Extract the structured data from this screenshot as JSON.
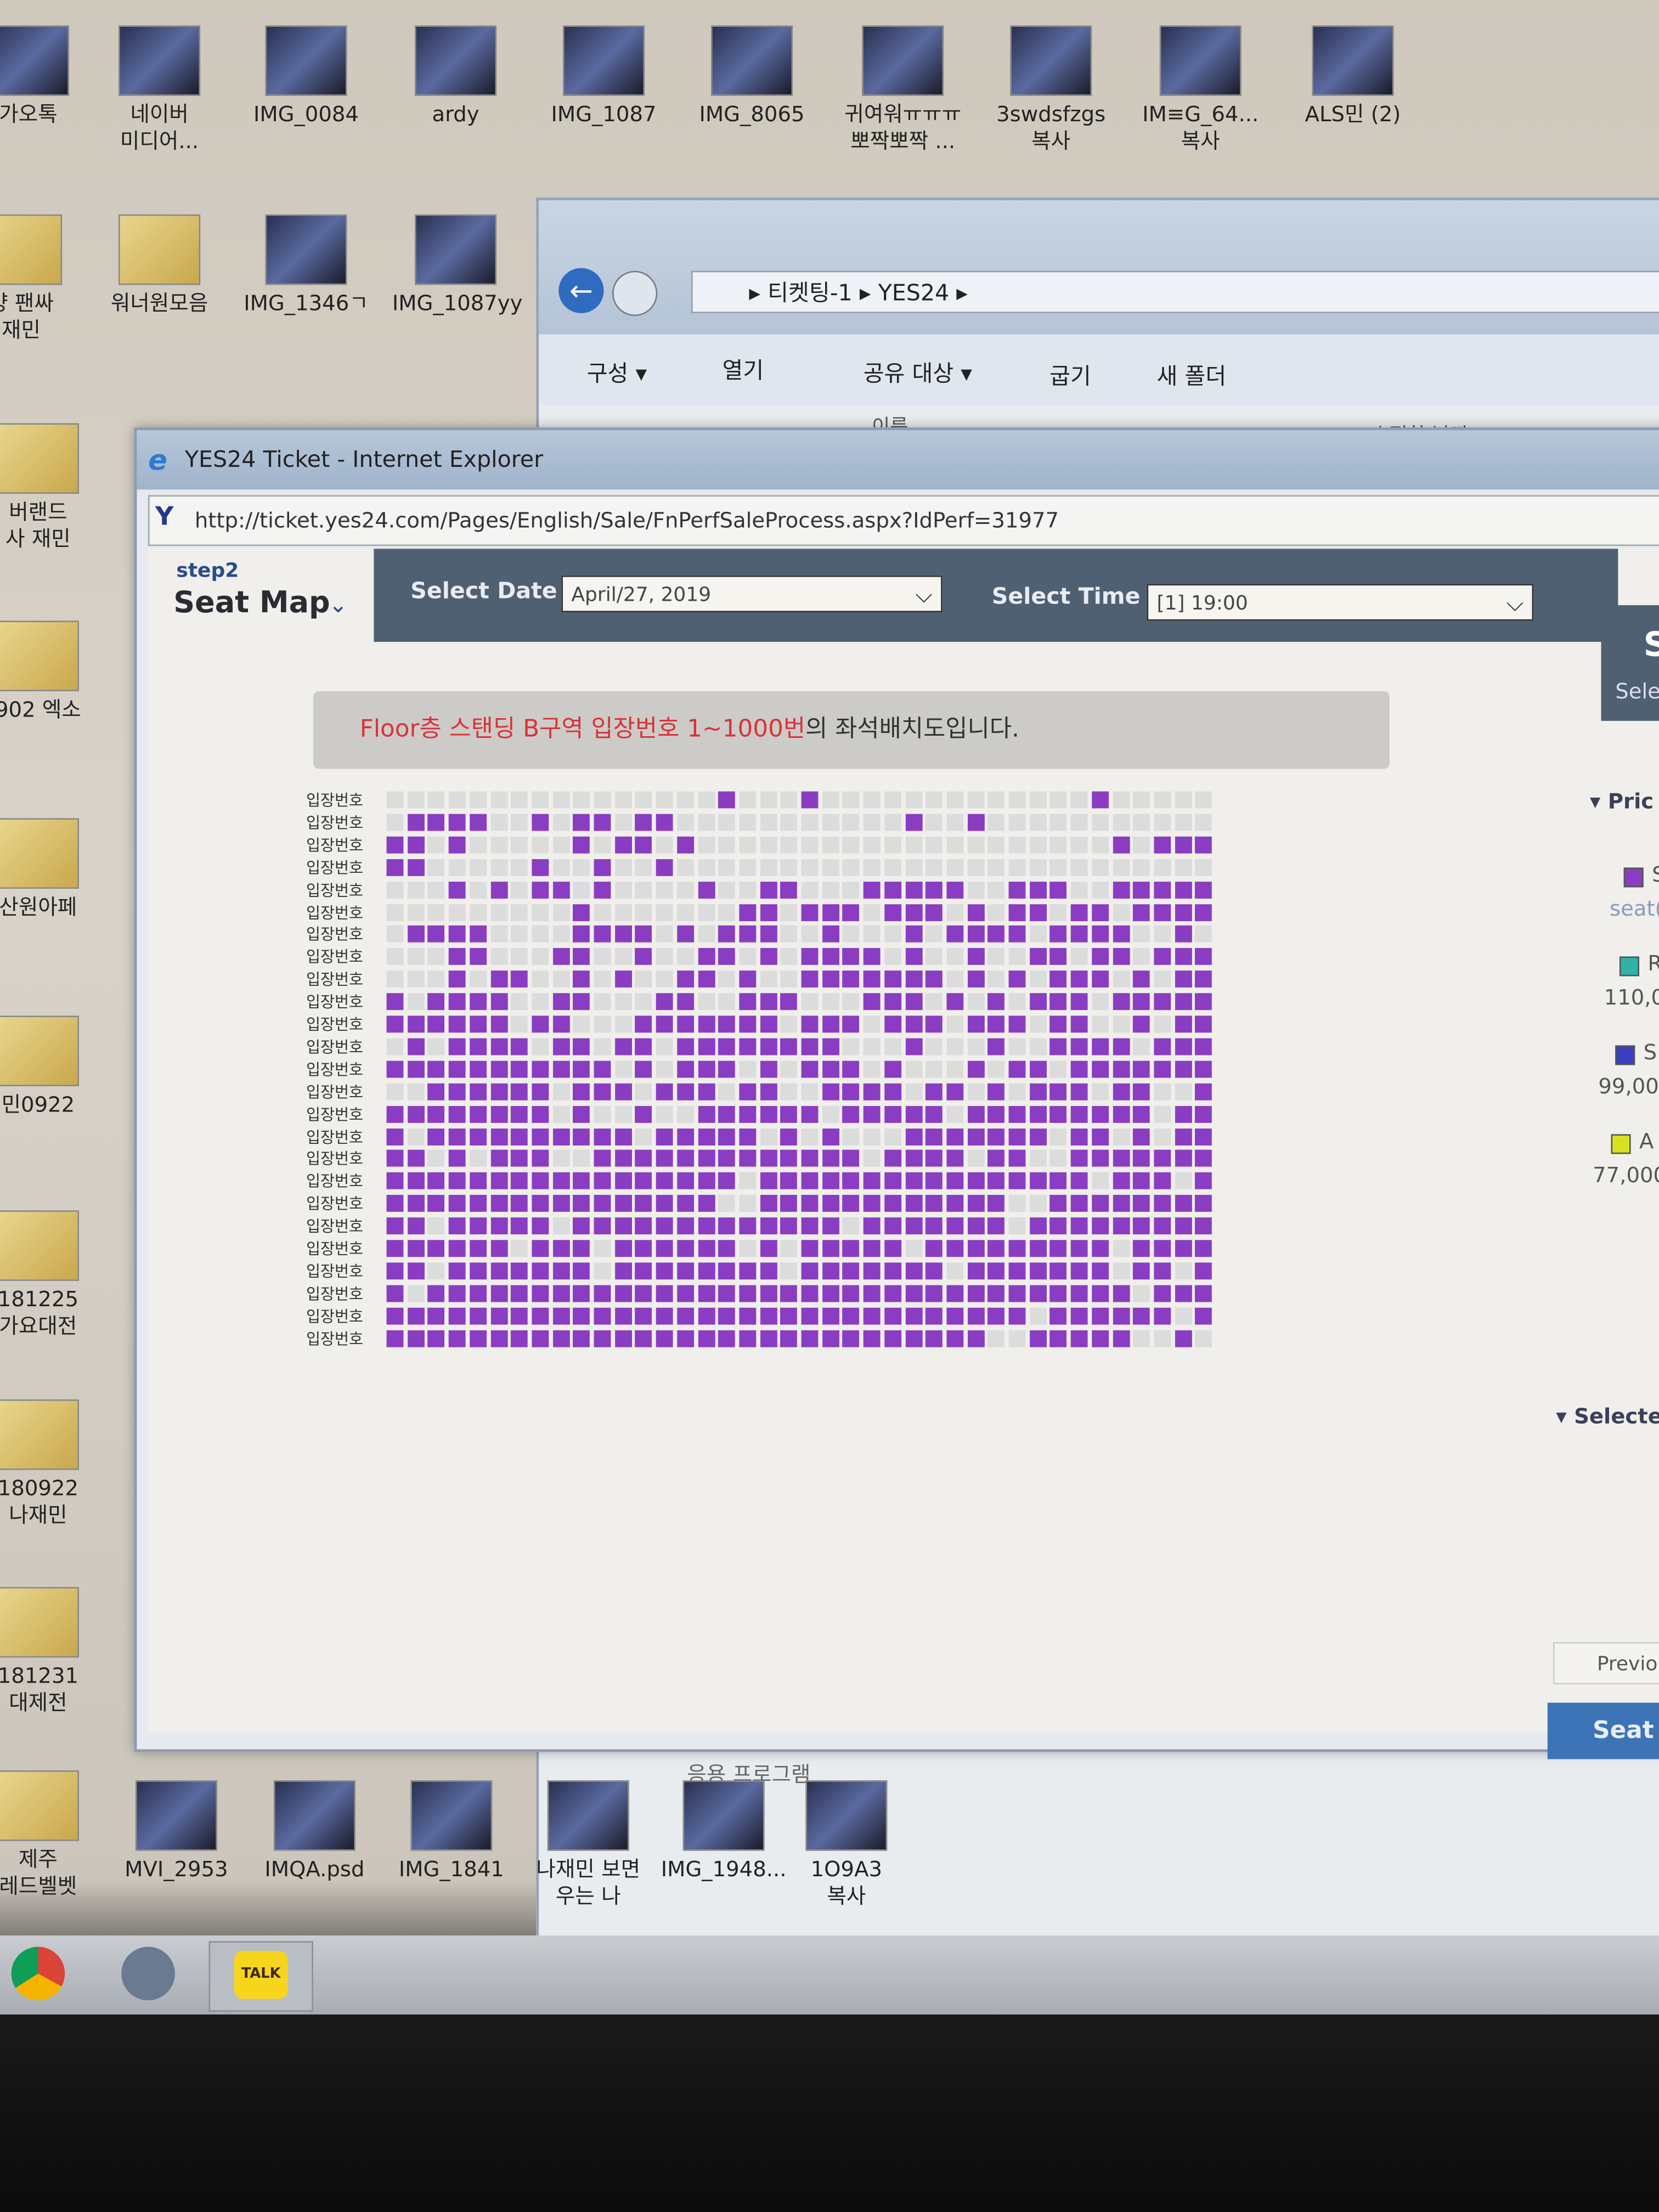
{
  "desktop": {
    "top_icons": [
      "가오톡",
      "네이버\n미디어...",
      "IMG_0084",
      "ardy",
      "IMG_1087",
      "IMG_8065",
      "귀여워ㅠㅠㅠ\n뽀짝뽀짝 ...",
      "3swdsfzgs\n복사",
      "IM≡G_64...\n복사",
      "ALS민 (2)"
    ],
    "second_row": [
      "양 팬싸\n재민",
      "워너원모음",
      "IMG_1346ㄱ",
      "IMG_1087yy"
    ],
    "left_column": [
      "버랜드\n사 재민",
      "902 엑소",
      "산원아페",
      "민0922",
      "181225\n가요대전",
      "180922\n나재민",
      "181231\n대제전",
      "제주\n레드벨벳"
    ],
    "bottom_row": [
      "MVI_2953",
      "IMQA.psd",
      "IMG_1841",
      "나재민 보면\n우는 나",
      "IMG_1948...",
      "1O9A3\n복사"
    ]
  },
  "explorer": {
    "breadcrumb": [
      "티켓팅-1",
      "YES24"
    ],
    "toolbar": [
      "구성 ▾",
      "열기",
      "공유 대상 ▾",
      "굽기",
      "새 폴더"
    ],
    "columns": [
      "이름",
      "수정한 날짜"
    ],
    "footer_item": "응용 프로그램"
  },
  "ie": {
    "title": "YES24 Ticket - Internet Explorer",
    "url": "http://ticket.yes24.com/Pages/English/Sale/FnPerfSaleProcess.aspx?IdPerf=31977",
    "step": "step2",
    "step_title": "Seat Map",
    "select_date_label": "Select Date",
    "select_date_value": "April/27, 2019",
    "select_time_label": "Select Time",
    "select_time_value": "[1] 19:00",
    "banner_red": "Floor층 스탠딩 B구역 입장번호 1~1000번",
    "banner_rest": "의 좌석배치도입니다.",
    "row_label": "입장번호",
    "colors": {
      "available": "#8a3dc2",
      "taken": "#dcdcdc",
      "header": "#4f6073",
      "banner_red": "#d8333b"
    },
    "seat_rows": [
      "0000000000000000100010000000000000100000001",
      "0111100101101100000000000100100000000000",
      "1101000001011010000000000000000000010111",
      "1100000100100100000000000000000000000000",
      "0001010110100001001100011111001110011111",
      "0000000001000000011011101110101101101111",
      "0111100001111010111001000101111011110010",
      "0001100011001001101011110100100110110111",
      "0001011001010011010011111110101011101011",
      "1011110011000110011100011101010111011111",
      "1111110110001111111011101110111011001011",
      "0101111011011011111111000100010011110111",
      "1111111111101011101011101000101101111111",
      "0011111101110111011001111011010111011001",
      "1111111101001001111110111110111111111011",
      "1011111111110111110101000111111101101011",
      "1101011100111111111111101111011001111111",
      "1111111111111111101111111111111111011101",
      "1111111111111111001111111111110011111111",
      "1101111101111111111111011111110111111111",
      "1111110111011111101011111011111111101111",
      "1101111111011111111011111110111111101101",
      "1011111111111111111111111111111111110111",
      "1111111111111111111111111111111011111101",
      "1111111111111111111111111111100111110010"
    ]
  },
  "right_panel": {
    "header_big": "S",
    "header_small": "Sele",
    "price_heading": "Pric",
    "legend": [
      {
        "color": "#8a3dc2",
        "label": "S",
        "sub": "seat("
      },
      {
        "color": "#2fb3a8",
        "label": "R",
        "sub": "110,0"
      },
      {
        "color": "#3a3fc0",
        "label": "S",
        "sub": "99,000"
      },
      {
        "color": "#d9e021",
        "label": "A s",
        "sub": "77,000"
      }
    ],
    "selected_heading": "Selecte",
    "prev_button": "Previou",
    "seat_button": "Seat S"
  },
  "taskbar": {
    "kakao": "TALK"
  }
}
